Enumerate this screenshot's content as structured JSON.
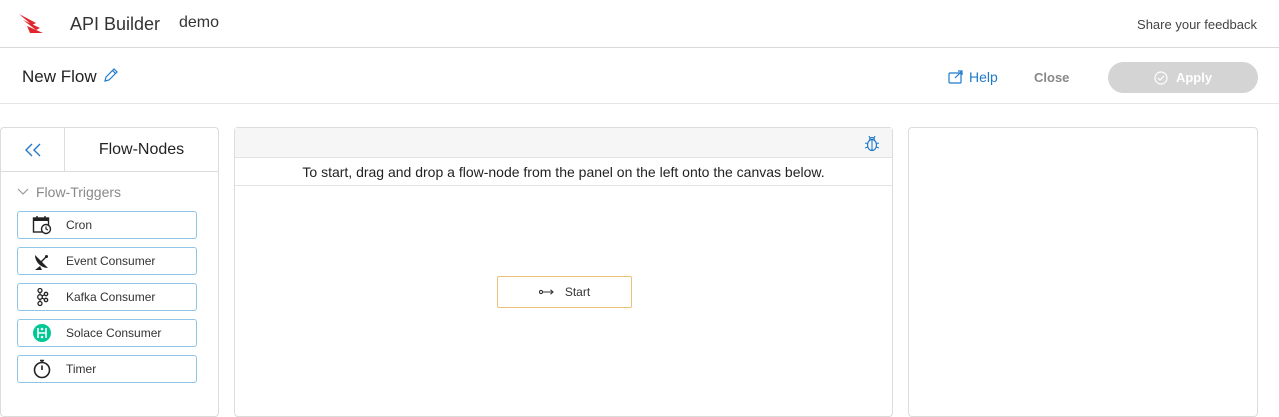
{
  "header": {
    "app_title": "API Builder",
    "project": "demo",
    "feedback_label": "Share your feedback",
    "brand_color": "#e0262c"
  },
  "flow": {
    "name": "New Flow",
    "help_label": "Help",
    "close_label": "Close",
    "apply_label": "Apply"
  },
  "left_panel": {
    "collapse_icon": "double-chevron-left-icon",
    "title": "Flow-Nodes",
    "section": {
      "label": "Flow-Triggers",
      "expanded": true
    },
    "nodes": [
      {
        "label": "Cron",
        "icon": "calendar-clock-icon"
      },
      {
        "label": "Event Consumer",
        "icon": "satellite-dish-icon"
      },
      {
        "label": "Kafka Consumer",
        "icon": "kafka-icon"
      },
      {
        "label": "Solace Consumer",
        "icon": "solace-icon"
      },
      {
        "label": "Timer",
        "icon": "stopwatch-icon"
      }
    ]
  },
  "canvas": {
    "debug_icon": "bug-icon",
    "instructions": "To start, drag and drop a flow-node from the panel on the left onto the canvas below.",
    "start_node": {
      "label": "Start",
      "icon": "start-arrow-icon"
    }
  },
  "colors": {
    "accent": "#1f7ac9",
    "node_border": "#8fc6e6",
    "start_border": "#e9c17a",
    "apply_disabled": "#d4d4d4"
  }
}
